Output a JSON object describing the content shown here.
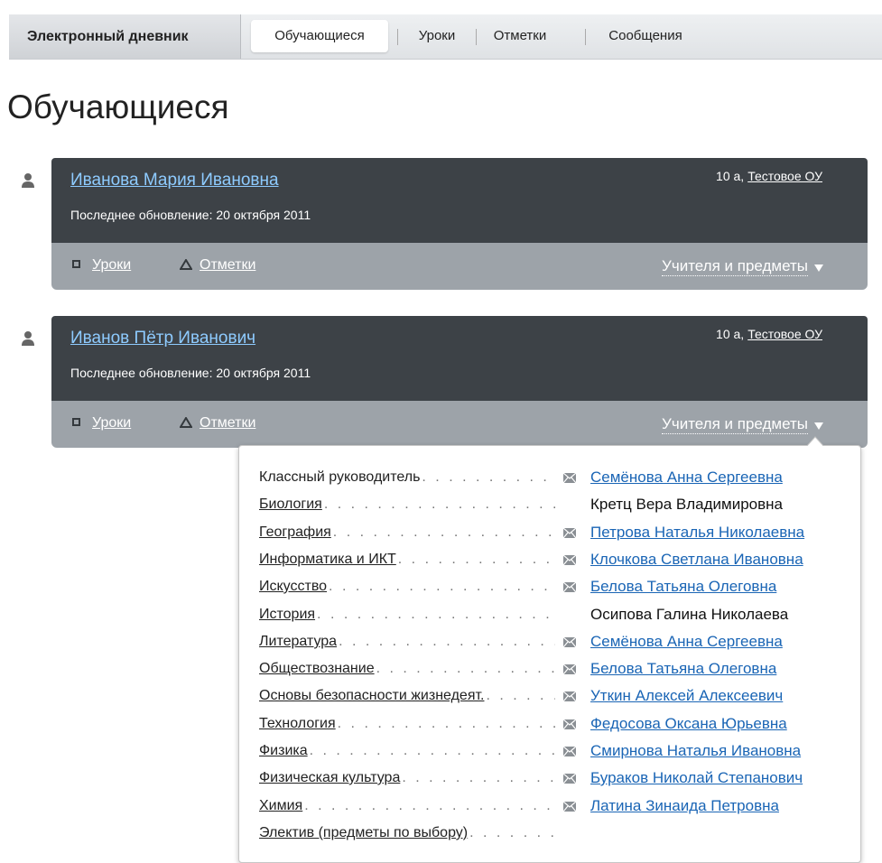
{
  "nav": {
    "brand": "Электронный дневник",
    "tabs": [
      "Обучающиеся",
      "Уроки",
      "Отметки",
      "Сообщения"
    ],
    "active_tab": "Обучающиеся"
  },
  "page_title": "Обучающиеся",
  "students": [
    {
      "name": "Иванова Мария Ивановна",
      "last_update": "Последнее обновление: 20 октября 2011",
      "class": "10 а,",
      "school": "Тестовое ОУ",
      "lessons_label": "Уроки",
      "marks_label": "Отметки",
      "teachers_label": "Учителя и предметы"
    },
    {
      "name": "Иванов Пётр Иванович",
      "last_update": "Последнее обновление: 20 октября 2011",
      "class": "10 а,",
      "school": "Тестовое ОУ",
      "lessons_label": "Уроки",
      "marks_label": "Отметки",
      "teachers_label": "Учителя и предметы"
    }
  ],
  "teachers_dropdown": {
    "rows": [
      {
        "subject": "Классный руководитель",
        "subject_is_link": false,
        "teacher": "Семёнова Анна Сергеевна",
        "teacher_is_link": true,
        "mail": true
      },
      {
        "subject": "Биология",
        "subject_is_link": true,
        "teacher": "Кретц Вера Владимировна",
        "teacher_is_link": false,
        "mail": false
      },
      {
        "subject": "География",
        "subject_is_link": true,
        "teacher": "Петрова Наталья Николаевна",
        "teacher_is_link": true,
        "mail": true
      },
      {
        "subject": "Информатика и ИКТ",
        "subject_is_link": true,
        "teacher": "Клочкова Светлана Ивановна",
        "teacher_is_link": true,
        "mail": true
      },
      {
        "subject": "Искусство",
        "subject_is_link": true,
        "teacher": "Белова Татьяна Олеговна",
        "teacher_is_link": true,
        "mail": true
      },
      {
        "subject": "История",
        "subject_is_link": true,
        "teacher": "Осипова Галина Николаева",
        "teacher_is_link": false,
        "mail": false
      },
      {
        "subject": "Литература",
        "subject_is_link": true,
        "teacher": "Семёнова Анна Сергеевна",
        "teacher_is_link": true,
        "mail": true
      },
      {
        "subject": "Обществознание",
        "subject_is_link": true,
        "teacher": "Белова Татьяна Олеговна",
        "teacher_is_link": true,
        "mail": true
      },
      {
        "subject": "Основы безопасности жизнедеят.",
        "subject_is_link": true,
        "teacher": "Уткин Алексей Алексеевич",
        "teacher_is_link": true,
        "mail": true
      },
      {
        "subject": "Технология",
        "subject_is_link": true,
        "teacher": "Федосова Оксана Юрьевна",
        "teacher_is_link": true,
        "mail": true
      },
      {
        "subject": "Физика",
        "subject_is_link": true,
        "teacher": "Смирнова Наталья Ивановна",
        "teacher_is_link": true,
        "mail": true
      },
      {
        "subject": "Физическая культура",
        "subject_is_link": true,
        "teacher": "Бураков Николай Степанович",
        "teacher_is_link": true,
        "mail": true
      },
      {
        "subject": "Химия",
        "subject_is_link": true,
        "teacher": "Латина Зинаида Петровна",
        "teacher_is_link": true,
        "mail": true
      },
      {
        "subject": "Электив (предметы по выбору)",
        "subject_is_link": true,
        "teacher": "",
        "teacher_is_link": false,
        "mail": false
      }
    ]
  },
  "colors": {
    "card_dark": "#3d4247",
    "card_light": "#9da3a9",
    "name_link": "#8ecbff",
    "teacher_link": "#1a65b5"
  },
  "icons": {
    "student": "person-icon",
    "lessons": "square-icon",
    "marks": "triangle-icon",
    "toggle": "caret-down-icon",
    "mail": "envelope-icon"
  }
}
